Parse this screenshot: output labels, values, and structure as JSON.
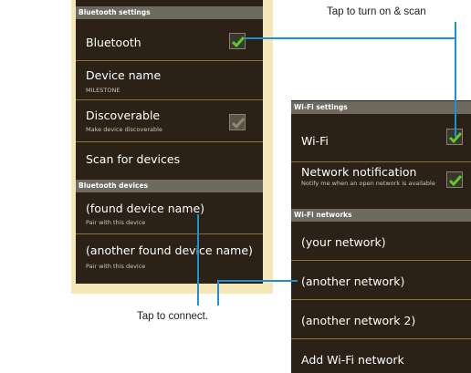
{
  "bluetooth_panel": {
    "settings_header": "Bluetooth settings",
    "bluetooth_label": "Bluetooth",
    "bluetooth_checked": true,
    "device_name_label": "Device name",
    "device_name_value": "MILESTONE",
    "discoverable_label": "Discoverable",
    "discoverable_sub": "Make device discoverable",
    "discoverable_checked": false,
    "scan_label": "Scan for devices",
    "devices_header": "Bluetooth devices",
    "devices": [
      {
        "name": "(found device name)",
        "sub": "Pair with this device"
      },
      {
        "name": "(another found device name)",
        "sub": "Pair with this device"
      }
    ]
  },
  "wifi_panel": {
    "settings_header": "Wi-Fi settings",
    "wifi_label": "Wi-Fi",
    "wifi_checked": true,
    "notification_label": "Network notification",
    "notification_sub": "Notify me when an open network is available",
    "notification_checked": true,
    "networks_header": "Wi-Fi networks",
    "networks": [
      "(your network)",
      "(another network)",
      "(another network 2)"
    ],
    "add_network_label": "Add Wi-Fi network"
  },
  "callouts": {
    "scan_text": "Tap to turn on & scan",
    "connect_text": "Tap to connect."
  },
  "colors": {
    "screen_bg": "#2b2116",
    "header_bg": "#6f6a60",
    "frame_bg": "#f6e7b8",
    "accent_line": "#1c8fd6",
    "check_green": "#5ecb2a"
  }
}
